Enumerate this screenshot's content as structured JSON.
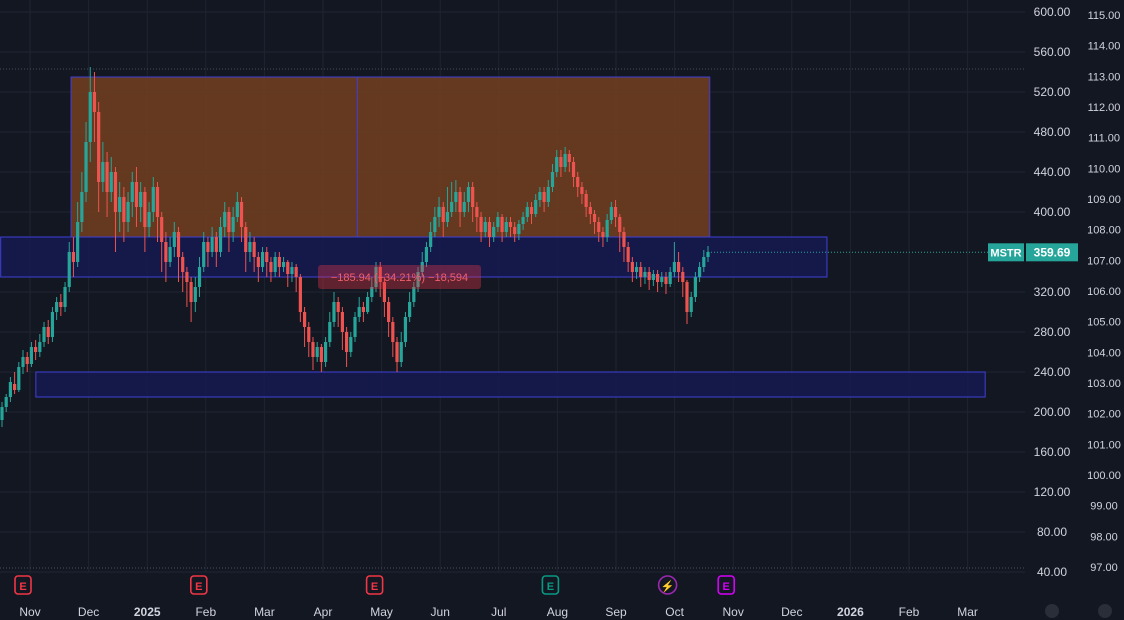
{
  "chart_data": {
    "type": "candlestick",
    "symbol": "MSTR",
    "last_price": "359.69",
    "price_axis": {
      "range": [
        40,
        600
      ],
      "ticks": [
        "600.00",
        "560.00",
        "520.00",
        "480.00",
        "440.00",
        "400.00",
        "320.00",
        "280.00",
        "240.00",
        "200.00",
        "160.00",
        "120.00",
        "80.00",
        "40.00"
      ]
    },
    "secondary_axis": {
      "range": [
        97,
        115
      ],
      "ticks": [
        "115.00",
        "114.00",
        "113.00",
        "112.00",
        "111.00",
        "110.00",
        "109.00",
        "108.00",
        "107.00",
        "106.00",
        "105.00",
        "104.00",
        "103.00",
        "102.00",
        "101.00",
        "100.00",
        "99.00",
        "98.00",
        "97.00"
      ]
    },
    "time_axis": {
      "labels": [
        {
          "text": "Nov",
          "x": 0,
          "bold": false
        },
        {
          "text": "Dec",
          "x": 1,
          "bold": false
        },
        {
          "text": "2025",
          "x": 2,
          "bold": true
        },
        {
          "text": "Feb",
          "x": 3,
          "bold": false
        },
        {
          "text": "Mar",
          "x": 4,
          "bold": false
        },
        {
          "text": "Apr",
          "x": 5,
          "bold": false
        },
        {
          "text": "May",
          "x": 6,
          "bold": false
        },
        {
          "text": "Jun",
          "x": 7,
          "bold": false
        },
        {
          "text": "Jul",
          "x": 8,
          "bold": false
        },
        {
          "text": "Aug",
          "x": 9,
          "bold": false
        },
        {
          "text": "Sep",
          "x": 10,
          "bold": false
        },
        {
          "text": "Oct",
          "x": 11,
          "bold": false
        },
        {
          "text": "Nov",
          "x": 12,
          "bold": false
        },
        {
          "text": "Dec",
          "x": 13,
          "bold": false
        },
        {
          "text": "2026",
          "x": 14,
          "bold": true
        },
        {
          "text": "Feb",
          "x": 15,
          "bold": false
        },
        {
          "text": "Mar",
          "x": 16,
          "bold": false
        }
      ]
    },
    "measure_label": "−185.94 (−34.21%) −18,594",
    "events": [
      {
        "type": "earnings",
        "label": "E",
        "month": 0
      },
      {
        "type": "earnings",
        "label": "E",
        "month": 3
      },
      {
        "type": "earnings",
        "label": "E",
        "month": 6
      },
      {
        "type": "earnings",
        "label": "E",
        "month": 9
      },
      {
        "type": "split",
        "label": "⚡",
        "month": 11
      },
      {
        "type": "earnings",
        "label": "E",
        "month": 12
      }
    ],
    "zones": [
      {
        "name": "orange-range",
        "from": 375,
        "to": 535,
        "start_month": 0.7,
        "end_month": 11.6
      },
      {
        "name": "upper-blue-zone",
        "from": 335,
        "to": 375,
        "start_month": -0.5,
        "end_month": 13.6
      },
      {
        "name": "lower-blue-zone",
        "from": 215,
        "to": 240,
        "start_month": 0.1,
        "end_month": 16.3
      }
    ],
    "colors": {
      "background": "#131722",
      "up": "#26a69a",
      "down": "#ef5350",
      "orange_zone": "#6b3d1f",
      "blue_zone": "#161a50",
      "zone_border": "#3f3fd6",
      "badge": "#26a69a",
      "earnings": "#f23645",
      "earnings_green": "#089981",
      "split": "#9c27b0"
    },
    "series": [
      [
        192,
        205,
        185,
        210
      ],
      [
        205,
        215,
        200,
        218
      ],
      [
        215,
        230,
        210,
        235
      ],
      [
        228,
        222,
        218,
        240
      ],
      [
        222,
        245,
        220,
        250
      ],
      [
        245,
        255,
        238,
        262
      ],
      [
        255,
        248,
        240,
        260
      ],
      [
        248,
        265,
        245,
        270
      ],
      [
        265,
        260,
        252,
        272
      ],
      [
        260,
        270,
        255,
        278
      ],
      [
        270,
        285,
        265,
        290
      ],
      [
        285,
        275,
        268,
        292
      ],
      [
        275,
        300,
        270,
        305
      ],
      [
        300,
        310,
        292,
        315
      ],
      [
        310,
        305,
        296,
        318
      ],
      [
        305,
        325,
        300,
        330
      ],
      [
        325,
        360,
        320,
        370
      ],
      [
        360,
        350,
        335,
        375
      ],
      [
        350,
        390,
        345,
        410
      ],
      [
        390,
        420,
        380,
        440
      ],
      [
        420,
        470,
        410,
        490
      ],
      [
        470,
        520,
        450,
        545
      ],
      [
        520,
        500,
        470,
        540
      ],
      [
        500,
        430,
        400,
        510
      ],
      [
        430,
        450,
        420,
        470
      ],
      [
        450,
        420,
        395,
        460
      ],
      [
        420,
        440,
        410,
        455
      ],
      [
        440,
        400,
        360,
        445
      ],
      [
        400,
        415,
        380,
        430
      ],
      [
        415,
        390,
        370,
        425
      ],
      [
        390,
        410,
        380,
        420
      ],
      [
        410,
        430,
        395,
        440
      ],
      [
        430,
        405,
        385,
        445
      ],
      [
        405,
        420,
        390,
        430
      ],
      [
        420,
        385,
        360,
        425
      ],
      [
        385,
        400,
        375,
        410
      ],
      [
        400,
        425,
        390,
        435
      ],
      [
        425,
        395,
        370,
        430
      ],
      [
        395,
        370,
        340,
        400
      ],
      [
        370,
        350,
        330,
        380
      ],
      [
        350,
        365,
        345,
        375
      ],
      [
        365,
        380,
        355,
        390
      ],
      [
        380,
        355,
        330,
        385
      ],
      [
        355,
        340,
        320,
        360
      ],
      [
        340,
        330,
        305,
        345
      ],
      [
        330,
        310,
        290,
        335
      ],
      [
        310,
        325,
        300,
        335
      ],
      [
        325,
        345,
        315,
        355
      ],
      [
        345,
        370,
        340,
        380
      ],
      [
        370,
        360,
        345,
        375
      ],
      [
        360,
        375,
        355,
        385
      ],
      [
        375,
        360,
        345,
        380
      ],
      [
        360,
        385,
        355,
        395
      ],
      [
        385,
        400,
        375,
        410
      ],
      [
        400,
        380,
        360,
        405
      ],
      [
        380,
        395,
        370,
        405
      ],
      [
        395,
        410,
        390,
        420
      ],
      [
        410,
        385,
        370,
        415
      ],
      [
        385,
        360,
        340,
        390
      ],
      [
        360,
        370,
        350,
        380
      ],
      [
        370,
        355,
        340,
        375
      ],
      [
        355,
        345,
        330,
        360
      ],
      [
        345,
        360,
        340,
        365
      ],
      [
        360,
        350,
        335,
        365
      ],
      [
        350,
        340,
        330,
        355
      ],
      [
        340,
        355,
        335,
        360
      ],
      [
        355,
        345,
        335,
        360
      ],
      [
        345,
        350,
        340,
        355
      ],
      [
        350,
        338,
        325,
        352
      ],
      [
        338,
        345,
        330,
        350
      ],
      [
        345,
        335,
        320,
        348
      ],
      [
        335,
        300,
        290,
        338
      ],
      [
        300,
        285,
        265,
        305
      ],
      [
        285,
        270,
        255,
        290
      ],
      [
        270,
        255,
        242,
        275
      ],
      [
        255,
        265,
        250,
        270
      ],
      [
        265,
        250,
        240,
        268
      ],
      [
        250,
        270,
        245,
        275
      ],
      [
        270,
        290,
        265,
        300
      ],
      [
        290,
        310,
        285,
        320
      ],
      [
        310,
        300,
        285,
        315
      ],
      [
        300,
        280,
        262,
        305
      ],
      [
        280,
        260,
        245,
        285
      ],
      [
        260,
        275,
        255,
        280
      ],
      [
        275,
        295,
        270,
        300
      ],
      [
        295,
        305,
        290,
        315
      ],
      [
        305,
        300,
        290,
        310
      ],
      [
        300,
        315,
        298,
        320
      ],
      [
        315,
        325,
        310,
        335
      ],
      [
        325,
        345,
        320,
        350
      ],
      [
        345,
        330,
        315,
        350
      ],
      [
        330,
        310,
        295,
        335
      ],
      [
        310,
        290,
        275,
        315
      ],
      [
        290,
        270,
        255,
        295
      ],
      [
        270,
        250,
        240,
        275
      ],
      [
        250,
        270,
        245,
        280
      ],
      [
        270,
        295,
        265,
        300
      ],
      [
        295,
        310,
        290,
        320
      ],
      [
        310,
        325,
        305,
        330
      ],
      [
        325,
        340,
        320,
        345
      ],
      [
        340,
        350,
        335,
        360
      ],
      [
        350,
        365,
        345,
        370
      ],
      [
        365,
        380,
        360,
        390
      ],
      [
        380,
        395,
        375,
        405
      ],
      [
        395,
        405,
        385,
        415
      ],
      [
        405,
        390,
        375,
        410
      ],
      [
        390,
        400,
        385,
        425
      ],
      [
        400,
        410,
        395,
        430
      ],
      [
        410,
        420,
        400,
        432
      ],
      [
        420,
        400,
        385,
        425
      ],
      [
        400,
        410,
        395,
        420
      ],
      [
        410,
        425,
        400,
        430
      ],
      [
        425,
        405,
        390,
        430
      ],
      [
        405,
        395,
        380,
        410
      ],
      [
        395,
        380,
        370,
        400
      ],
      [
        380,
        390,
        375,
        395
      ],
      [
        390,
        375,
        365,
        395
      ],
      [
        375,
        385,
        370,
        390
      ],
      [
        385,
        395,
        380,
        400
      ],
      [
        395,
        380,
        370,
        398
      ],
      [
        380,
        390,
        375,
        395
      ],
      [
        390,
        385,
        375,
        395
      ],
      [
        385,
        378,
        370,
        390
      ],
      [
        378,
        388,
        372,
        392
      ],
      [
        388,
        395,
        382,
        400
      ],
      [
        395,
        405,
        390,
        410
      ],
      [
        405,
        398,
        388,
        410
      ],
      [
        398,
        412,
        395,
        418
      ],
      [
        412,
        420,
        405,
        425
      ],
      [
        420,
        410,
        400,
        425
      ],
      [
        410,
        425,
        405,
        432
      ],
      [
        425,
        440,
        420,
        448
      ],
      [
        440,
        455,
        435,
        462
      ],
      [
        455,
        445,
        435,
        462
      ],
      [
        445,
        458,
        440,
        465
      ],
      [
        458,
        450,
        440,
        462
      ],
      [
        450,
        435,
        425,
        455
      ],
      [
        435,
        425,
        415,
        440
      ],
      [
        425,
        418,
        408,
        430
      ],
      [
        418,
        405,
        395,
        422
      ],
      [
        405,
        398,
        388,
        410
      ],
      [
        398,
        390,
        378,
        402
      ],
      [
        390,
        380,
        370,
        395
      ],
      [
        380,
        375,
        365,
        385
      ],
      [
        375,
        392,
        370,
        398
      ],
      [
        392,
        405,
        388,
        410
      ],
      [
        405,
        395,
        385,
        412
      ],
      [
        395,
        380,
        360,
        398
      ],
      [
        380,
        365,
        350,
        385
      ],
      [
        365,
        350,
        340,
        370
      ],
      [
        350,
        340,
        330,
        355
      ],
      [
        340,
        345,
        333,
        350
      ],
      [
        345,
        335,
        325,
        350
      ],
      [
        335,
        340,
        328,
        345
      ],
      [
        340,
        332,
        322,
        345
      ],
      [
        332,
        338,
        326,
        342
      ],
      [
        338,
        330,
        320,
        342
      ],
      [
        330,
        335,
        325,
        340
      ],
      [
        335,
        328,
        318,
        340
      ],
      [
        328,
        340,
        325,
        345
      ],
      [
        340,
        350,
        335,
        370
      ],
      [
        350,
        340,
        330,
        360
      ],
      [
        340,
        330,
        315,
        345
      ],
      [
        330,
        300,
        288,
        332
      ],
      [
        300,
        315,
        295,
        320
      ],
      [
        315,
        335,
        310,
        340
      ],
      [
        335,
        345,
        330,
        350
      ],
      [
        345,
        355,
        340,
        362
      ],
      [
        355,
        360,
        350,
        366
      ]
    ]
  }
}
